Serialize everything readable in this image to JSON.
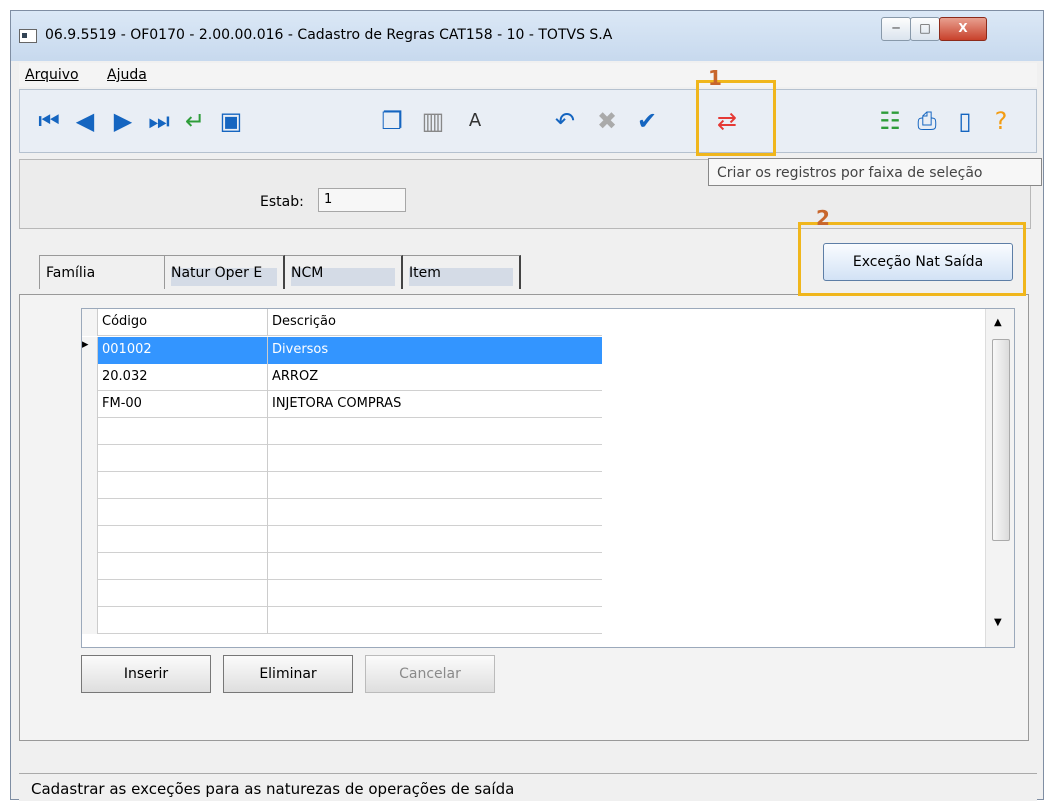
{
  "window": {
    "title": "06.9.5519 - OF0170 - 2.00.00.016 - Cadastro de Regras CAT158 - 10 - TOTVS S.A"
  },
  "menu": {
    "file": "Arquivo",
    "help": "Ajuda"
  },
  "annotations": {
    "num1": "1",
    "num2": "2"
  },
  "tooltip": "Criar os registros por faixa de seleção",
  "estab": {
    "label": "Estab:",
    "value": "1"
  },
  "tabs": [
    "Família",
    "Natur Oper E",
    "NCM",
    "Item"
  ],
  "exception_button": "Exceção Nat Saída",
  "grid": {
    "columns": [
      "Código",
      "Descrição"
    ],
    "rows": [
      {
        "code": "001002",
        "desc": "Diversos",
        "selected": true
      },
      {
        "code": "20.032",
        "desc": "ARROZ",
        "selected": false
      },
      {
        "code": "FM-00",
        "desc": "INJETORA COMPRAS",
        "selected": false
      }
    ]
  },
  "buttons": {
    "insert": "Inserir",
    "delete": "Eliminar",
    "cancel": "Cancelar"
  },
  "status": "Cadastrar as exceções para as naturezas de operações de saída"
}
